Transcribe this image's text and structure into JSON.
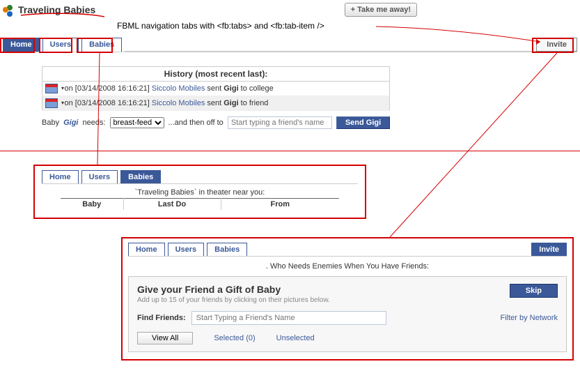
{
  "app": {
    "title": "Traveling Babies"
  },
  "header": {
    "take_away": "Take me away!"
  },
  "annotation": {
    "caption": "FBML navigation tabs with <fb:tabs> and <fb:tab-item />"
  },
  "main_tabs": {
    "home": "Home",
    "users": "Users",
    "babies": "Babies",
    "invite": "Invite"
  },
  "history": {
    "heading": "History (most recent last):",
    "rows": [
      {
        "ts": "on [03/14/2008 16:16:21]",
        "user": "Siccolo Mobiles",
        "mid": " sent ",
        "baby": "Gigi",
        "dest": " to college"
      },
      {
        "ts": "on [03/14/2008 16:16:21]",
        "user": "Siccolo Mobiles",
        "mid": " sent ",
        "baby": "Gigi",
        "dest": " to friend"
      }
    ]
  },
  "needs": {
    "prefix": "Baby ",
    "baby_name": "Gigi",
    "needs_label": " needs:",
    "select_value": "breast-feed",
    "then_off": "...and then off to",
    "friend_placeholder": "Start typing a friend's name",
    "send_btn": "Send Gigi"
  },
  "inset_babies": {
    "tabs": {
      "home": "Home",
      "users": "Users",
      "babies": "Babies"
    },
    "caption": "`Traveling Babies` in theater near you:",
    "cols": {
      "baby": "Baby",
      "lastdo": "Last Do",
      "from": "From"
    }
  },
  "inset_invite": {
    "tabs": {
      "home": "Home",
      "users": "Users",
      "babies": "Babies",
      "invite": "Invite"
    },
    "subtitle": ". Who Needs Enemies When You Have Friends:",
    "gift_title": "Give your Friend a Gift of Baby",
    "gift_sub": "Add up to 15 of your friends by clicking on their pictures below.",
    "skip": "Skip",
    "find_label": "Find Friends:",
    "find_placeholder": "Start Typing a Friend's Name",
    "filter": "Filter by Network",
    "view_all": "View All",
    "selected": "Selected (0)",
    "unselected": "Unselected"
  }
}
